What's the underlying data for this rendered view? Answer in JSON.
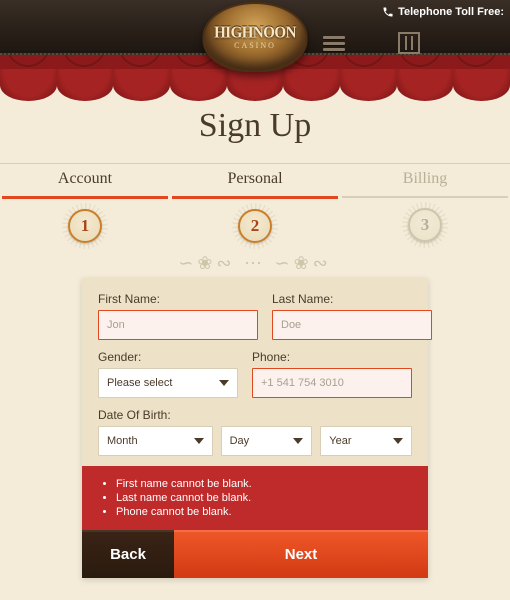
{
  "header": {
    "phone_label": "Telephone Toll Free:",
    "logo_line1": "HIGHNOON",
    "logo_line2": "CASINO"
  },
  "page_title": "Sign Up",
  "steps": [
    {
      "label": "Account",
      "num": "1",
      "state": "done"
    },
    {
      "label": "Personal",
      "num": "2",
      "state": "active"
    },
    {
      "label": "Billing",
      "num": "3",
      "state": "inactive"
    }
  ],
  "form": {
    "first_name": {
      "label": "First Name:",
      "placeholder": "Jon",
      "value": ""
    },
    "last_name": {
      "label": "Last Name:",
      "placeholder": "Doe",
      "value": ""
    },
    "gender": {
      "label": "Gender:",
      "placeholder": "Please select"
    },
    "phone": {
      "label": "Phone:",
      "placeholder": "+1 541 754 3010",
      "value": ""
    },
    "dob": {
      "label": "Date Of Birth:",
      "month": "Month",
      "day": "Day",
      "year": "Year"
    }
  },
  "errors": [
    "First name cannot be blank.",
    "Last name cannot be blank.",
    "Phone cannot be blank."
  ],
  "buttons": {
    "back": "Back",
    "next": "Next"
  }
}
